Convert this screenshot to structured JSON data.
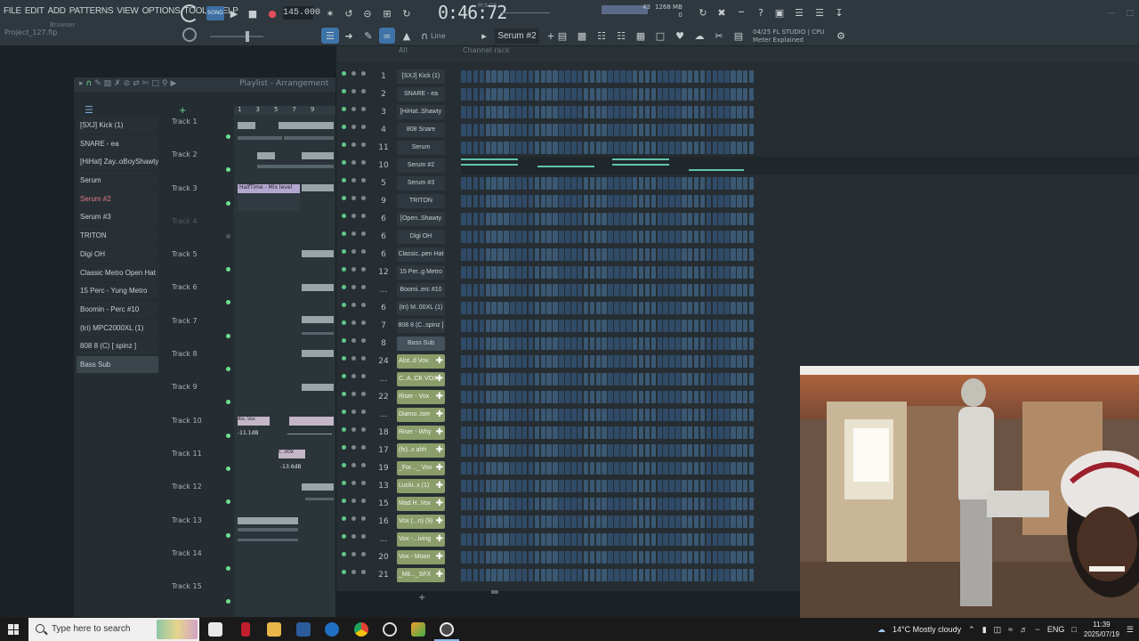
{
  "menu": [
    "FILE",
    "EDIT",
    "ADD",
    "PATTERNS",
    "VIEW",
    "OPTIONS",
    "TOOLS",
    "HELP"
  ],
  "project_name": "Project_127.flp",
  "browser_label": "Browser",
  "transport": {
    "mode": "SONG",
    "tempo": "145.000",
    "time": "0:46:72",
    "time_sub": "M:S:CS"
  },
  "perf": {
    "cpu": "43",
    "memory": "1268 MB",
    "voices": "0"
  },
  "toolbar2": {
    "snap": "Line",
    "pattern": "Serum #2",
    "hint_version": "04/25",
    "hint_app": "FL STUDIO | CPU",
    "hint_text": "Meter Explained"
  },
  "playlist": {
    "title": "Playlist - Arrangement",
    "picker": [
      "[SXJ] Kick (1)",
      "SNARE - ea",
      "[HiHat] Zay..oBoyShawty",
      "Serum",
      "Serum #2",
      "Serum #3",
      "TRITON",
      "Digi OH",
      "Classic Metro Open Hat",
      "15 Perc - Yung Metro",
      "Boomin - Perc #10",
      "(tri) MPC2000XL (1)",
      "808 8 (C) [ spinz ]",
      "Bass Sub"
    ],
    "tracks": [
      "Track 1",
      "Track 2",
      "Track 3",
      "Track 4",
      "Track 5",
      "Track 6",
      "Track 7",
      "Track 8",
      "Track 9",
      "Track 10",
      "Track 11",
      "Track 12",
      "Track 13",
      "Track 14",
      "Track 15"
    ],
    "clip_labels": {
      "halftime": "HalfTime - Mix level",
      "vox": "Alo..Vox",
      "vol1": "-11.1dB",
      "vol2": "-13.6dB",
      "cv": "C..VOX"
    },
    "ruler": [
      "1",
      "3",
      "5",
      "7",
      "9"
    ]
  },
  "rack": {
    "title": "Channel rack",
    "filter": "All",
    "channels": [
      {
        "num": "1",
        "name": "[SXJ] Kick (1)",
        "kind": "steps"
      },
      {
        "num": "2",
        "name": "SNARE - ea",
        "kind": "steps"
      },
      {
        "num": "3",
        "name": "[HiHat..Shawty",
        "kind": "steps"
      },
      {
        "num": "4",
        "name": "808 Snare",
        "kind": "steps"
      },
      {
        "num": "11",
        "name": "Serum",
        "kind": "steps"
      },
      {
        "num": "10",
        "name": "Serum #2",
        "kind": "roll"
      },
      {
        "num": "5",
        "name": "Serum #3",
        "kind": "steps"
      },
      {
        "num": "9",
        "name": "TRITON",
        "kind": "steps"
      },
      {
        "num": "6",
        "name": "[Open..Shawty",
        "kind": "steps"
      },
      {
        "num": "6",
        "name": "Digi OH",
        "kind": "steps"
      },
      {
        "num": "6",
        "name": "Classic..pen Hat",
        "kind": "steps"
      },
      {
        "num": "12",
        "name": "15 Per..g Metro",
        "kind": "steps"
      },
      {
        "num": "...",
        "name": "Boomi..erc #10",
        "kind": "steps"
      },
      {
        "num": "6",
        "name": "(tri) M..00XL (1)",
        "kind": "steps"
      },
      {
        "num": "7",
        "name": "808 8 (C..spinz ]",
        "kind": "steps"
      },
      {
        "num": "8",
        "name": "Bass Sub",
        "kind": "sub"
      },
      {
        "num": "24",
        "name": "Alot..d Vox",
        "kind": "audio"
      },
      {
        "num": "...",
        "name": "C..A..CK VOX",
        "kind": "audio"
      },
      {
        "num": "22",
        "name": "Riser - Vox",
        "kind": "audio"
      },
      {
        "num": "...",
        "name": "Diamo..iser",
        "kind": "audio"
      },
      {
        "num": "18",
        "name": "Riser - Why",
        "kind": "audio"
      },
      {
        "num": "17",
        "name": "(fx)..x ahh",
        "kind": "audio"
      },
      {
        "num": "19",
        "name": "_For..._ Vox",
        "kind": "audio"
      },
      {
        "num": "13",
        "name": "Lucki..x (1)",
        "kind": "audio"
      },
      {
        "num": "15",
        "name": "Mad H..Vox",
        "kind": "audio"
      },
      {
        "num": "16",
        "name": "Vox (...n) (9)",
        "kind": "audio"
      },
      {
        "num": "...",
        "name": "Vox -...iving",
        "kind": "audio"
      },
      {
        "num": "20",
        "name": "Vox - Moon",
        "kind": "audio"
      },
      {
        "num": "21",
        "name": "_Mil..._SFX",
        "kind": "audio"
      }
    ]
  },
  "taskbar": {
    "search_placeholder": "Type here to search",
    "weather": "14°C  Mostly cloudy",
    "lang": "ENG",
    "time": "11:39",
    "date": "2025/07/19"
  },
  "colors": {
    "accent_green": "#6ee08e",
    "step_blue": "#334a66",
    "audio_clip": "#8b9d6a",
    "note_teal": "#61c3ac"
  }
}
